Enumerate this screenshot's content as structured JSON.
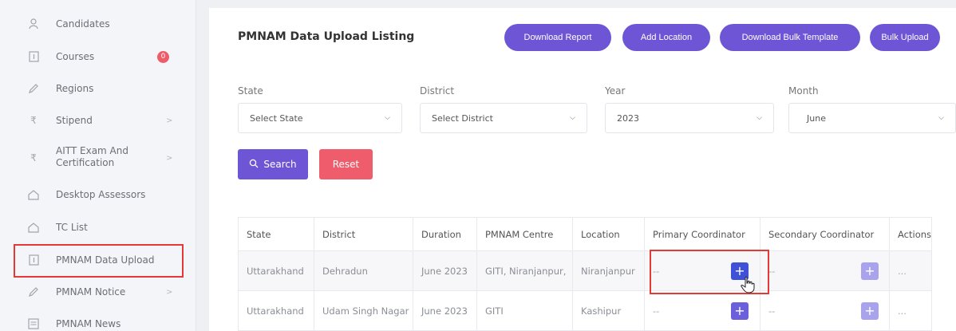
{
  "sidebar": {
    "items": [
      {
        "label": "Candidates",
        "icon": "users-icon"
      },
      {
        "label": "Courses",
        "icon": "book-icon",
        "badge": "0"
      },
      {
        "label": "Regions",
        "icon": "pencil-icon"
      },
      {
        "label": "Stipend",
        "icon": "rupee-icon",
        "chevron": ">"
      },
      {
        "label": "AITT Exam And",
        "label2": "Certification",
        "icon": "rupee-icon",
        "chevron": ">"
      },
      {
        "label": "Desktop Assessors",
        "icon": "home-icon"
      },
      {
        "label": "TC List",
        "icon": "home-icon"
      },
      {
        "label": "PMNAM Data Upload",
        "icon": "book-icon"
      },
      {
        "label": "PMNAM Notice",
        "icon": "pencil-icon",
        "chevron": ">"
      },
      {
        "label": "PMNAM News",
        "icon": "news-icon"
      }
    ]
  },
  "header": {
    "title": "PMNAM Data Upload Listing",
    "buttons": [
      "Download Report",
      "Add Location",
      "Download Bulk Template",
      "Bulk Upload"
    ]
  },
  "filters": {
    "state": {
      "label": "State",
      "value": "Select State"
    },
    "district": {
      "label": "District",
      "value": "Select District"
    },
    "year": {
      "label": "Year",
      "value": "2023"
    },
    "month": {
      "label": "Month",
      "value": "June"
    },
    "search_label": "Search",
    "reset_label": "Reset"
  },
  "table": {
    "headers": [
      "State",
      "District",
      "Duration",
      "PMNAM Centre",
      "Location",
      "Primary Coordinator",
      "Secondary Coordinator",
      "Actions"
    ],
    "rows": [
      {
        "state": "Uttarakhand",
        "district": "Dehradun",
        "duration": "June 2023",
        "centre": "GITI, Niranjanpur,",
        "location": "Niranjanpur",
        "primary": "--",
        "secondary": "--",
        "actions": "..."
      },
      {
        "state": "Uttarakhand",
        "district": "Udam Singh Nagar",
        "duration": "June 2023",
        "centre": "GITI",
        "location": "Kashipur",
        "primary": "--",
        "secondary": "--",
        "actions": "..."
      }
    ]
  },
  "colors": {
    "accent": "#6d55d6",
    "danger": "#ef5c6b",
    "highlight": "#e53935"
  }
}
